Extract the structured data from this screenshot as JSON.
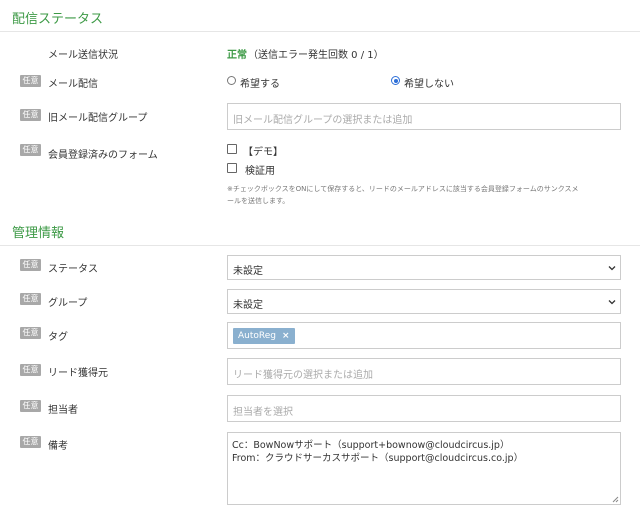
{
  "delivery_section": {
    "title": "配信ステータス",
    "mail_status": {
      "label": "メール送信状況",
      "status": "正常",
      "detail": "（送信エラー発生回数 0 / 1）"
    },
    "mail_delivery": {
      "badge": "任意",
      "label": "メール配信",
      "options": [
        "希望する",
        "希望しない"
      ],
      "selected": "希望しない"
    },
    "old_group": {
      "badge": "任意",
      "label": "旧メール配信グループ",
      "placeholder": "旧メール配信グループの選択または追加"
    },
    "forms": {
      "badge": "任意",
      "label": "会員登録済みのフォーム",
      "checkboxes": [
        {
          "label": "【デモ】",
          "checked": false
        },
        {
          "label": "検証用",
          "checked": false
        }
      ],
      "note_line1": "※チェックボックスをONにして保存すると、リードのメールアドレスに該当する会員登録フォームのサンクスメ",
      "note_line2": "ールを送信します。"
    }
  },
  "management_section": {
    "title": "管理情報",
    "status": {
      "badge": "任意",
      "label": "ステータス",
      "value": "未設定"
    },
    "group": {
      "badge": "任意",
      "label": "グループ",
      "value": "未設定"
    },
    "tag": {
      "badge": "任意",
      "label": "タグ",
      "tags": [
        "AutoReg"
      ],
      "remove_symbol": "×"
    },
    "lead_source": {
      "badge": "任意",
      "label": "リード獲得元",
      "placeholder": "リード獲得元の選択または追加"
    },
    "owner": {
      "badge": "任意",
      "label": "担当者",
      "placeholder": "担当者を選択"
    },
    "remarks": {
      "badge": "任意",
      "label": "備考",
      "lines": [
        "Cc：BowNowサポート（support+bownow@cloudcircus.jp）",
        "From：クラウドサーカスサポート（support@cloudcircus.co.jp）"
      ]
    }
  },
  "colors": {
    "accent_green": "#3d9a46",
    "badge_gray": "#a8a8a8",
    "tag_blue": "#8ab0cf",
    "radio_blue": "#2e6fd8"
  }
}
